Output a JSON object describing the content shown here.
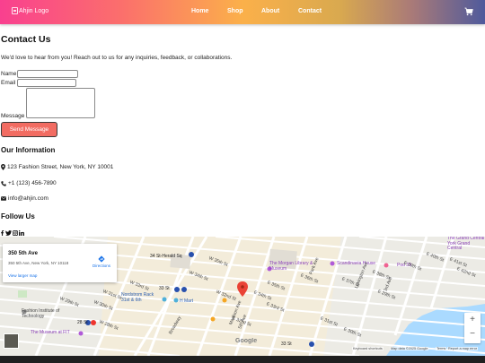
{
  "header": {
    "logo_alt": "Ahjin Logo",
    "nav": [
      {
        "label": "Home"
      },
      {
        "label": "Shop"
      },
      {
        "label": "About"
      },
      {
        "label": "Contact"
      }
    ],
    "cart_icon": "cart-icon"
  },
  "contact": {
    "title": "Contact Us",
    "intro": "We'd love to hear from you! Reach out to us for any inquiries, feedback, or collaborations.",
    "form": {
      "name_label": "Name",
      "email_label": "Email",
      "message_label": "Message",
      "name_value": "",
      "email_value": "",
      "message_value": "",
      "submit_label": "Send Message"
    }
  },
  "info": {
    "title": "Our Information",
    "address": "123 Fashion Street, New York, NY 10001",
    "phone": "+1 (123) 456-7890",
    "email": "info@ahjin.com",
    "icons": [
      "map-marker-icon",
      "phone-icon",
      "envelope-icon"
    ]
  },
  "follow": {
    "title": "Follow Us",
    "icons": [
      "facebook-icon",
      "twitter-icon",
      "instagram-icon",
      "linkedin-icon"
    ]
  },
  "map": {
    "place_title": "350 5th Ave",
    "place_address": "350 5th Ave, New York, NY 10118",
    "directions_label": "Directions",
    "larger_map_label": "View larger map",
    "zoom_in": "+",
    "zoom_out": "−",
    "google_label": "Google",
    "attribution": [
      "Keyboard shortcuts",
      "Map data ©2025 Google",
      "Terms",
      "Report a map error"
    ],
    "labels": {
      "herald_sq": "34 St-Herald Sq",
      "morgan": "The Morgan Library & Museum",
      "scandinavia": "Scandinavia House",
      "pod39": "Pod 39",
      "grand_central": "The Grand Central York Grand Central",
      "nordstrom": "Nordstrom Rack 31st & 6th",
      "h_mart": "H Mart",
      "fit": "Fashion Institute of Technology",
      "museum_fit": "The Museum at FIT",
      "st28": "28 St",
      "st33": "33 St",
      "st33b": "33 St",
      "w35": "W 35th St",
      "w34": "W 34th St",
      "w33": "W 33rd St",
      "w32": "W 32nd St",
      "w31": "W 31st St",
      "w30": "W 30th St",
      "w29": "W 29th St",
      "w28": "W 28th St",
      "e34": "E 34th St",
      "e35": "E 35th St",
      "e36": "E 36th St",
      "e37": "E 37th St",
      "e38": "E 38th St",
      "e39": "E 39th St",
      "e40": "E 40th St",
      "e41": "E 41st St",
      "e42": "E 42nd St",
      "e33": "E 33rd St",
      "e32": "E 32nd St",
      "e31": "E 31st St",
      "e30": "E 30th St",
      "e29": "E 29th St",
      "madison": "Madison Ave",
      "park": "Park Ave",
      "lexington": "Lexington Ave",
      "third": "3rd Ave",
      "broadway": "Broadway",
      "fifth": "5th Ave"
    }
  }
}
